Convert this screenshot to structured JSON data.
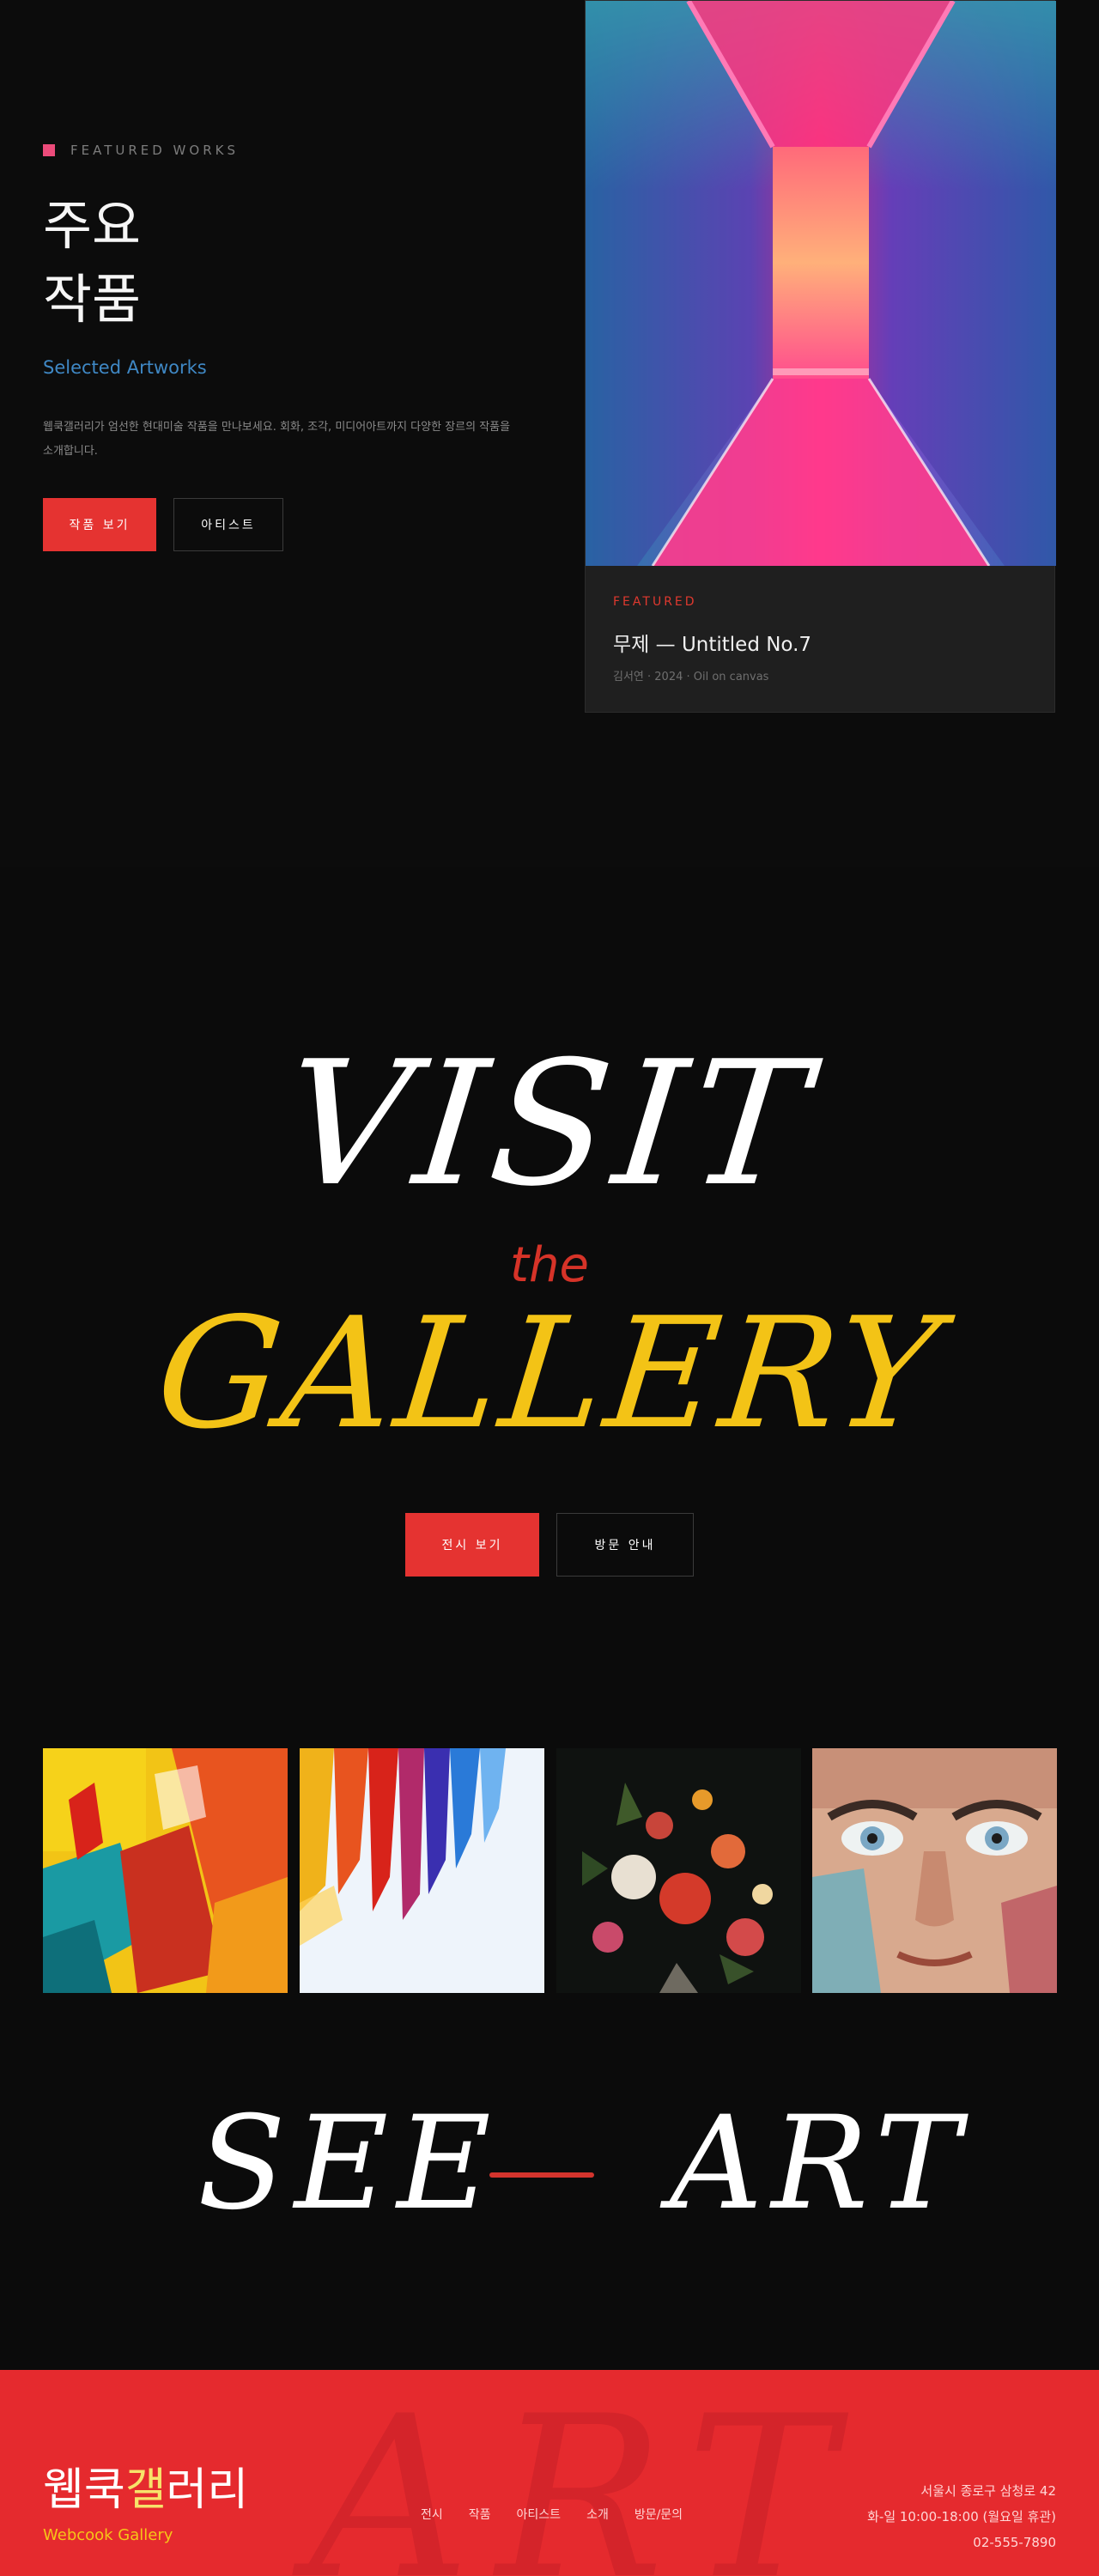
{
  "featured": {
    "eyebrow": "FEATURED WORKS",
    "title_line1": "주요",
    "title_line2": "작품",
    "subtitle": "Selected Artworks",
    "description": "웹쿡갤러리가 엄선한 현대미술 작품을 만나보세요. 회화, 조각, 미디어아트까지 다양한 장르의 작품을 소개합니다.",
    "btn_works": "작품 보기",
    "btn_artists": "아티스트",
    "card": {
      "label": "FEATURED",
      "title": "무제 — Untitled No.7",
      "meta": "김서연 · 2024 · Oil on canvas"
    }
  },
  "visit": {
    "word1": "VISIT",
    "word2": "the",
    "word3": "GALLERY",
    "btn_exhibitions": "전시 보기",
    "btn_visit_info": "방문 안내"
  },
  "see_art": {
    "left": "SEE",
    "right": "ART"
  },
  "footer": {
    "logo_part1": "웹쿡",
    "logo_part2": "갤",
    "logo_part3": "러리",
    "logo_sub": "Webcook Gallery",
    "bg_word": "ART",
    "nav": [
      "전시",
      "작품",
      "아티스트",
      "소개",
      "방문/문의"
    ],
    "address": "서울시 종로구 삼청로 42",
    "hours": "화-일 10:00-18:00 (월요일 휴관)",
    "phone": "02-555-7890"
  },
  "colors": {
    "accent_red": "#e53331",
    "accent_yellow": "#f3c316",
    "accent_blue": "#3f88c5",
    "footer_red": "#e52a2e"
  }
}
